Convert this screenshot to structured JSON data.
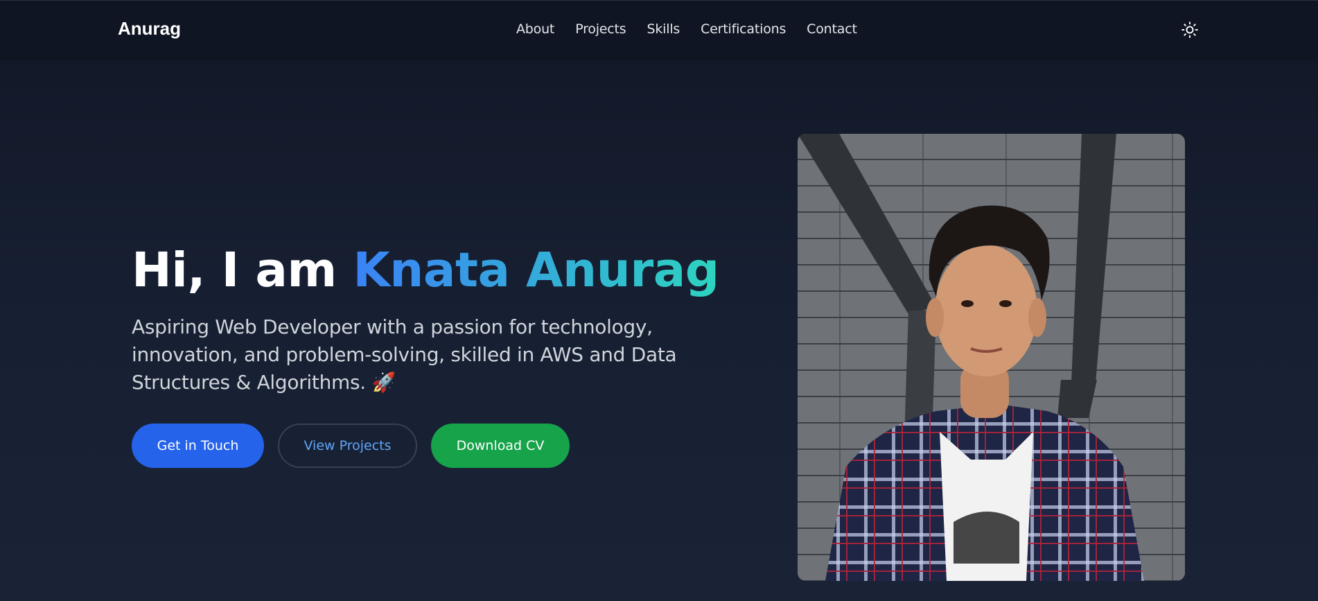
{
  "navbar": {
    "brand": "Anurag",
    "links": [
      "About",
      "Projects",
      "Skills",
      "Certifications",
      "Contact"
    ],
    "theme_toggle_icon": "sun-icon"
  },
  "hero": {
    "title_prefix": "Hi, I am",
    "title_name": "Knata Anurag",
    "description": "Aspiring Web Developer with a passion for technology, innovation, and problem-solving, skilled in AWS and Data Structures & Algorithms.",
    "emoji": "🚀",
    "buttons": {
      "get_in_touch": "Get in Touch",
      "view_projects": "View Projects",
      "download_cv": "Download CV"
    }
  },
  "colors": {
    "accent_blue": "#2563eb",
    "accent_green": "#16a34a",
    "gradient_start": "#3b82f6",
    "gradient_end": "#2dd4bf",
    "background": "#111827"
  }
}
